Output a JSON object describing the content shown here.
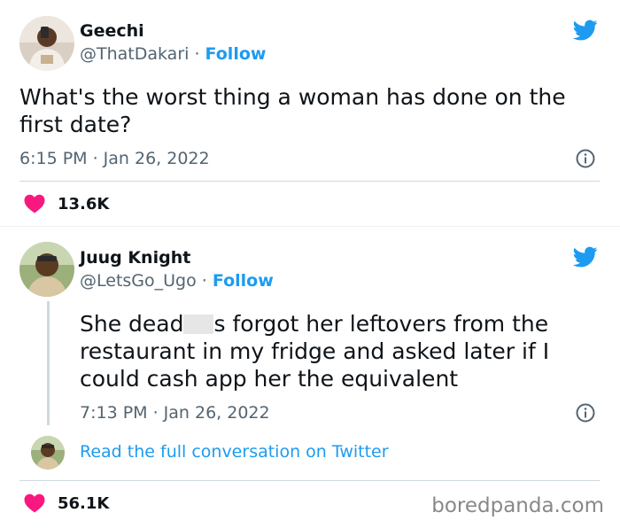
{
  "tweet1": {
    "name": "Geechi",
    "handle": "@ThatDakari",
    "separator": " · ",
    "follow_label": "Follow",
    "text_line1": "What's the worst thing a woman has done on the",
    "text_line2": "first date?",
    "timestamp": "6:15 PM · Jan 26, 2022",
    "likes": "13.6K"
  },
  "tweet2": {
    "name": "Juug Knight",
    "handle": "@LetsGo_Ugo",
    "separator": " · ",
    "follow_label": "Follow",
    "text_line1_a": "She dead",
    "text_line1_b": "s forgot her leftovers from the",
    "text_line2": "restaurant in my fridge and asked later if I",
    "text_line3": "could cash app her the equivalent",
    "timestamp": "7:13 PM · Jan 26, 2022",
    "read_link": "Read the full conversation on Twitter",
    "likes": "56.1K"
  },
  "watermark": "boredpanda.com",
  "colors": {
    "twitter_blue": "#1d9bf0",
    "heart_pink": "#f91880",
    "secondary_text": "#536471",
    "divider": "#cfd9de"
  },
  "icons": [
    "twitter-bird-icon",
    "info-icon",
    "heart-icon"
  ]
}
